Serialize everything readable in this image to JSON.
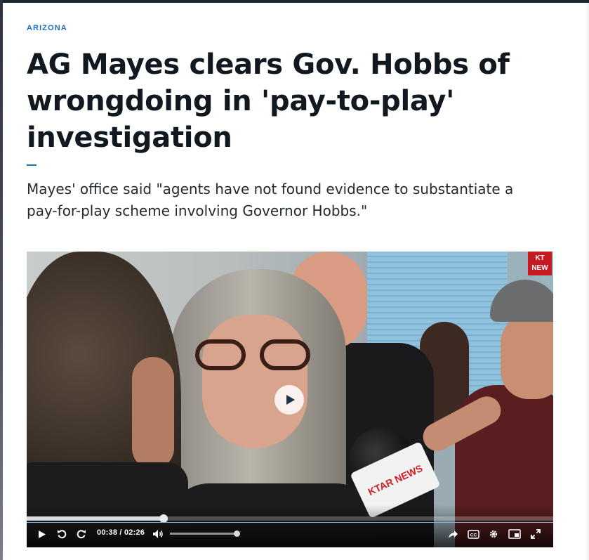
{
  "article": {
    "section": "ARIZONA",
    "headline_lines": [
      "AG Mayes clears Gov. Hobbs of",
      "wrongdoing in 'pay-to-play'",
      "investigation"
    ],
    "subhead_lines": [
      "Mayes' office said \"agents have not found evidence to substantiate a",
      "pay-for-play scheme involving Governor Hobbs.\""
    ],
    "accent_color": "#1d6fb8"
  },
  "video": {
    "current_time": "00:38",
    "separator": "/",
    "duration": "02:26",
    "progress_fraction": 0.26,
    "volume_fraction": 0.95,
    "mic_flag_text": "KTAR NEWS",
    "station_bug_text": "KT NEW",
    "icons": [
      "play-icon",
      "replay-icon",
      "forward-icon",
      "volume-icon",
      "share-icon",
      "captions-icon",
      "settings-icon",
      "cast-icon",
      "fullscreen-icon"
    ]
  }
}
